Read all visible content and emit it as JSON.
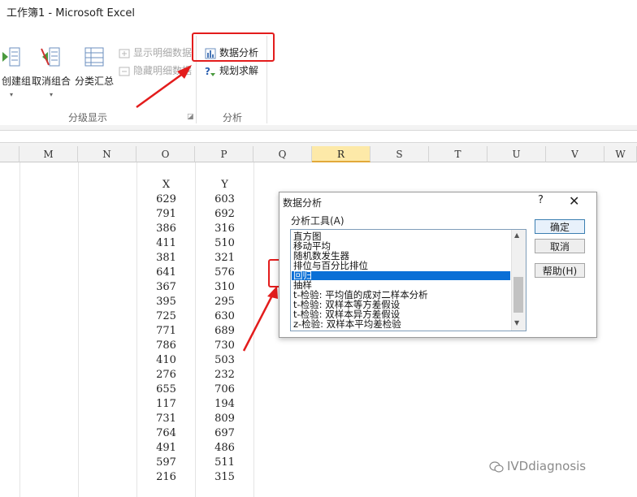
{
  "window": {
    "title": "工作簿1 - Microsoft Excel"
  },
  "ribbon": {
    "outline_group": {
      "label": "分级显示",
      "buttons": [
        {
          "label": "创建组",
          "icon": "group-icon"
        },
        {
          "label": "取消组合",
          "icon": "ungroup-icon"
        },
        {
          "label": "分类汇总",
          "icon": "subtotal-icon"
        }
      ],
      "small_buttons": [
        {
          "label": "显示明细数据",
          "icon": "show-detail-icon",
          "enabled": false
        },
        {
          "label": "隐藏明细数据",
          "icon": "hide-detail-icon",
          "enabled": false
        }
      ]
    },
    "analysis_group": {
      "label": "分析",
      "buttons": [
        {
          "label": "数据分析",
          "icon": "data-analysis-icon"
        },
        {
          "label": "规划求解",
          "icon": "solver-icon"
        }
      ]
    }
  },
  "sheet": {
    "columns": [
      "M",
      "N",
      "O",
      "P",
      "Q",
      "R",
      "S",
      "T",
      "U",
      "V",
      "W"
    ],
    "selected_column": "R",
    "headers": {
      "x": "X",
      "y": "Y"
    },
    "x_values": [
      "629",
      "791",
      "386",
      "411",
      "381",
      "641",
      "367",
      "395",
      "725",
      "771",
      "786",
      "410",
      "276",
      "655",
      "117",
      "731",
      "764",
      "491",
      "597",
      "216"
    ],
    "y_values": [
      "603",
      "692",
      "316",
      "510",
      "321",
      "576",
      "310",
      "295",
      "630",
      "689",
      "730",
      "503",
      "232",
      "706",
      "194",
      "809",
      "697",
      "486",
      "511",
      "315"
    ]
  },
  "dialog": {
    "title": "数据分析",
    "help": "?",
    "close": "✕",
    "tools_label": "分析工具(A)",
    "tools": [
      "直方图",
      "移动平均",
      "随机数发生器",
      "排位与百分比排位",
      "回归",
      "抽样",
      "t-检验: 平均值的成对二样本分析",
      "t-检验: 双样本等方差假设",
      "t-检验: 双样本异方差假设",
      "z-检验: 双样本平均差检验"
    ],
    "selected_tool": "回归",
    "ok": "确定",
    "cancel": "取消",
    "help_button": "帮助(H)"
  },
  "watermark": {
    "text": "IVDdiagnosis",
    "icon": "wechat-icon"
  },
  "colors": {
    "callout": "#e31c1c",
    "selection": "#0a6fd6",
    "selected_header": "#fde9a8"
  }
}
